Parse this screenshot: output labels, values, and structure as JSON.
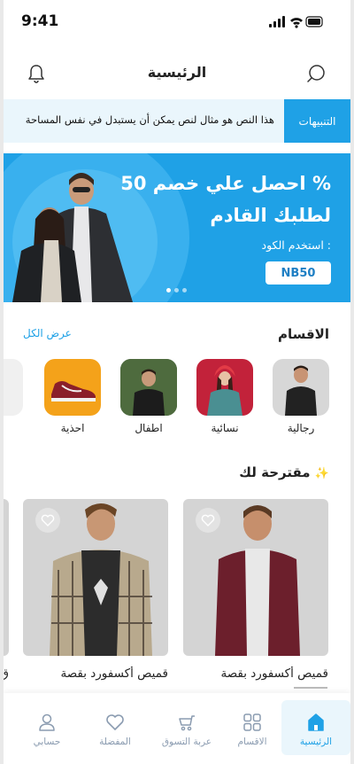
{
  "status_bar": {
    "time": "9:41"
  },
  "header": {
    "title": "الرئيسية"
  },
  "notifications": {
    "label": "التنبيهات",
    "text": "هذا النص هو مثال لنص يمكن أن يستبدل في نفس المساحة"
  },
  "banner": {
    "line1": "احصل علي خصم 50 %",
    "line2": "لطلبك القادم",
    "code_label": "استخدم الكود :",
    "code": "NB50"
  },
  "categories": {
    "title": "الاقسام",
    "view_all": "عرض الكل",
    "items": [
      {
        "label": "رجالية"
      },
      {
        "label": "نسائية"
      },
      {
        "label": "اطفال"
      },
      {
        "label": "احذية"
      },
      {
        "label": "سا"
      }
    ]
  },
  "suggested": {
    "title": "مقترحة لك",
    "products": [
      {
        "name": "قميص أكسفورد بقصة"
      },
      {
        "name": "قميص أكسفورد بقصة"
      },
      {
        "name": "ق"
      }
    ]
  },
  "bottom_nav": {
    "items": [
      {
        "label": "الرئيسية",
        "icon": "home-icon",
        "active": true
      },
      {
        "label": "الاقسام",
        "icon": "grid-icon",
        "active": false
      },
      {
        "label": "عربة التسوق",
        "icon": "cart-icon",
        "active": false
      },
      {
        "label": "المفضلة",
        "icon": "heart-icon",
        "active": false
      },
      {
        "label": "حسابي",
        "icon": "user-icon",
        "active": false
      }
    ]
  },
  "colors": {
    "accent": "#1fa1e6",
    "accent_light": "#eaf6fc",
    "nav_inactive": "#8a9bb0"
  }
}
